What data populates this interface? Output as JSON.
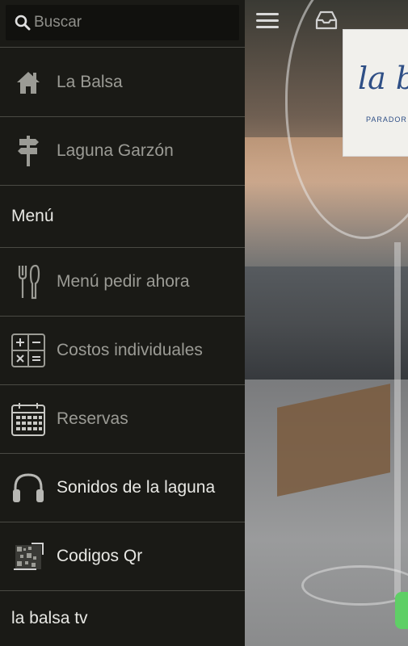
{
  "search": {
    "placeholder": "Buscar"
  },
  "drawer": {
    "items": [
      {
        "label": "La Balsa",
        "icon": "house-icon",
        "type": "link"
      },
      {
        "label": "Laguna Garzón",
        "icon": "signpost-icon",
        "type": "link"
      },
      {
        "label": "Menú",
        "type": "header"
      },
      {
        "label": "Menú pedir ahora",
        "icon": "fork-knife-icon",
        "type": "link"
      },
      {
        "label": "Costos individuales",
        "icon": "calculator-icon",
        "type": "link"
      },
      {
        "label": "Reservas",
        "icon": "calendar-icon",
        "type": "link"
      },
      {
        "label": "Sonidos de la laguna",
        "icon": "headphones-icon",
        "type": "link"
      },
      {
        "label": "Codigos Qr",
        "icon": "qr-code-icon",
        "type": "link"
      },
      {
        "label": "la balsa tv",
        "type": "header"
      }
    ]
  },
  "background": {
    "logo_text": "la b",
    "logo_subtext": "PARADOR L"
  },
  "colors": {
    "drawer_bg": "#1a1a16",
    "divider": "#4a4a44",
    "label_dim": "#9b9b95",
    "label_bright": "#e8e8e4",
    "logo_blue": "#2f4f86",
    "accent_green": "#5fcf66"
  }
}
